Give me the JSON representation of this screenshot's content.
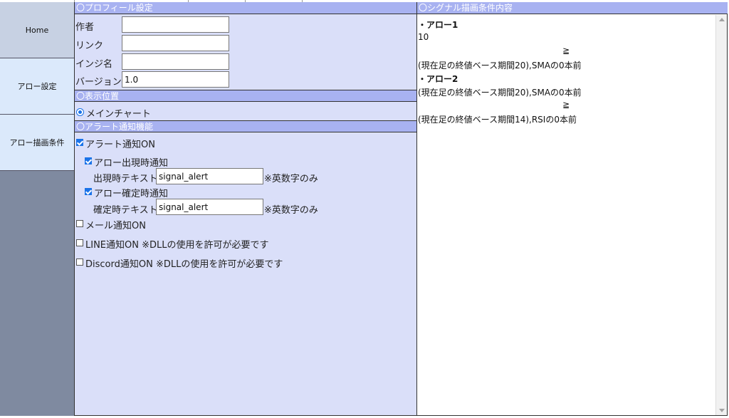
{
  "sidebar": {
    "home": "Home",
    "arrow_settings": "アロー設定",
    "arrow_conditions": "アロー描画条件"
  },
  "profile": {
    "header": "〇プロフィール設定",
    "author_label": "作者",
    "author_value": "",
    "link_label": "リンク",
    "link_value": "",
    "indicator_label": "インジ名",
    "indicator_value": "",
    "version_label": "バージョン",
    "version_value": "1.0"
  },
  "display": {
    "header": "〇表示位置",
    "main_chart": "メインチャート"
  },
  "alert": {
    "header": "〇アラート通知機能",
    "alert_on": "アラート通知ON",
    "arrow_appear": "アロー出現時通知",
    "appear_text_label": "出現時テキスト",
    "appear_text_value": "signal_alert",
    "appear_note": "※英数字のみ",
    "arrow_confirm": "アロー確定時通知",
    "confirm_text_label": "確定時テキスト",
    "confirm_text_value": "signal_alert",
    "confirm_note": "※英数字のみ",
    "mail_on": "メール通知ON",
    "line_on": "LINE通知ON ※DLLの使用を許可が必要です",
    "discord_on": "Discord通知ON ※DLLの使用を許可が必要です"
  },
  "signal": {
    "header": "〇シグナル描画条件内容",
    "arrow1_title": "・アロー1",
    "arrow1_line1": "10",
    "arrow1_op": "≧",
    "arrow1_line2": "(現在足の終値ベース期間20),SMAの0本前",
    "arrow2_title": "・アロー2",
    "arrow2_line1": "(現在足の終値ベース期間20),SMAの0本前",
    "arrow2_op": "≧",
    "arrow2_line2": "(現在足の終値ベース期間14),RSIの0本前"
  },
  "colors": {
    "section_header": "#a8b2f1",
    "panel_bg": "#dadff9",
    "sidebar_bg": "#7f8aa0",
    "nav_active": "#c7d1e3",
    "nav_item": "#dbe9fb",
    "check_accent": "#1a73e8"
  }
}
